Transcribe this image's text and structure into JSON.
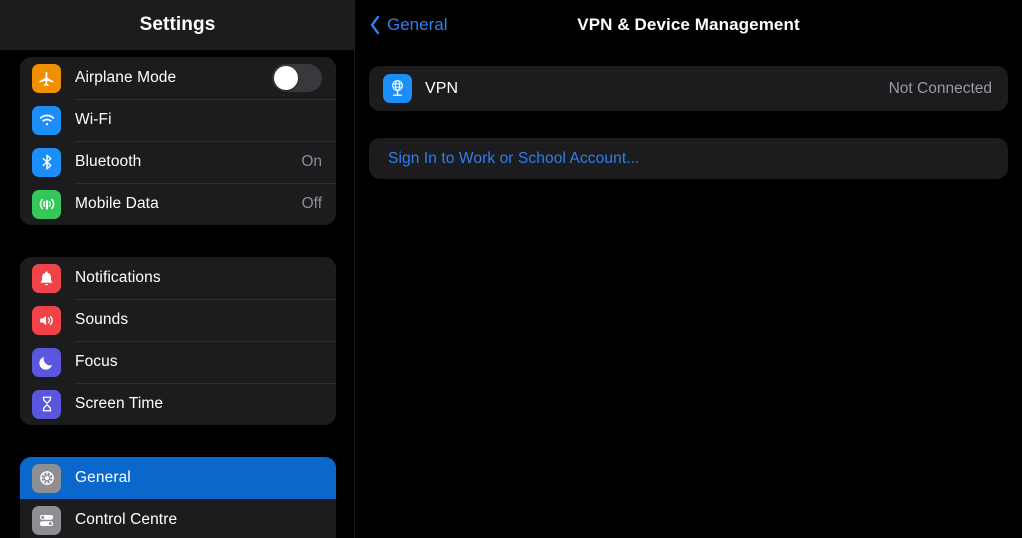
{
  "sidebar": {
    "title": "Settings",
    "groups": [
      {
        "items": [
          {
            "label": "Airplane Mode",
            "icon": "airplane-icon",
            "icon_color": "#F09000",
            "control": "toggle",
            "toggle_on": false
          },
          {
            "label": "Wi-Fi",
            "icon": "wifi-icon",
            "icon_color": "#1C8EF9",
            "control": "none",
            "value": ""
          },
          {
            "label": "Bluetooth",
            "icon": "bluetooth-icon",
            "icon_color": "#1C8EF9",
            "control": "value",
            "value": "On"
          },
          {
            "label": "Mobile Data",
            "icon": "mobile-data-icon",
            "icon_color": "#35C759",
            "control": "value",
            "value": "Off"
          }
        ]
      },
      {
        "items": [
          {
            "label": "Notifications",
            "icon": "bell-icon",
            "icon_color": "#F04349",
            "control": "none",
            "value": ""
          },
          {
            "label": "Sounds",
            "icon": "speaker-icon",
            "icon_color": "#F04349",
            "control": "none",
            "value": ""
          },
          {
            "label": "Focus",
            "icon": "moon-icon",
            "icon_color": "#5A56DE",
            "control": "none",
            "value": ""
          },
          {
            "label": "Screen Time",
            "icon": "hourglass-icon",
            "icon_color": "#5A56DE",
            "control": "none",
            "value": ""
          }
        ]
      },
      {
        "items": [
          {
            "label": "General",
            "icon": "gear-icon",
            "icon_color": "#8E8E93",
            "control": "none",
            "value": "",
            "selected": true
          },
          {
            "label": "Control Centre",
            "icon": "control-centre-icon",
            "icon_color": "#8E8E93",
            "control": "none",
            "value": "",
            "selected": false
          }
        ]
      }
    ],
    "selection_color": "#0A68CC"
  },
  "detail": {
    "back_label": "General",
    "title": "VPN & Device Management",
    "vpn_row": {
      "label": "VPN",
      "value": "Not Connected",
      "icon": "vpn-globe-icon",
      "icon_color": "#1C8EF9"
    },
    "signin_row": {
      "label": "Sign In to Work or School Account...",
      "link_color": "#2F7FEF"
    }
  }
}
